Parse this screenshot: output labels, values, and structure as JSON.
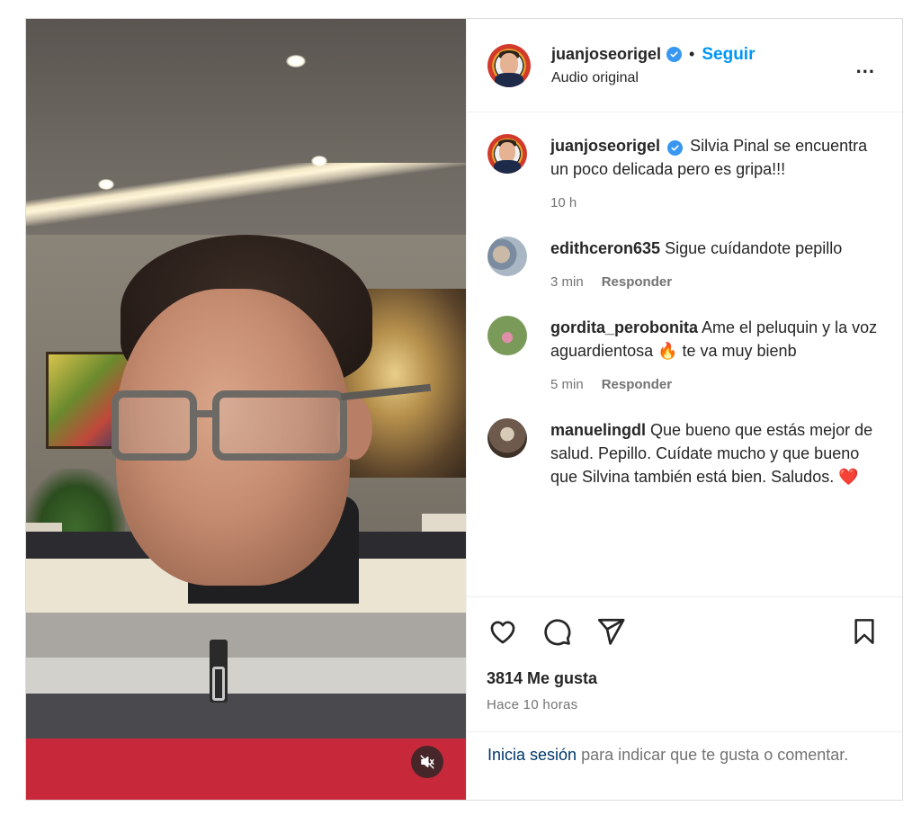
{
  "post": {
    "author": "juanjoseorigel",
    "follow_label": "Seguir",
    "separator": "•",
    "audio": "Audio original",
    "more_label": "..."
  },
  "caption": {
    "user": "juanjoseorigel",
    "text": "Silvia Pinal se encuentra un poco delicada pero es gripa!!!",
    "time": "10 h"
  },
  "comments": [
    {
      "user": "edithceron635",
      "text": "Sigue cuídandote pepillo",
      "time": "3 min",
      "reply": "Responder"
    },
    {
      "user": "gordita_perobonita",
      "text": "Ame el peluquin y la voz aguardientosa 🔥 te va muy bienb",
      "time": "5 min",
      "reply": "Responder"
    },
    {
      "user": "manuelingdl",
      "text": "Que bueno que estás mejor de salud. Pepillo. Cuídate mucho y que bueno que Silvina también está bien. Saludos. ❤️"
    }
  ],
  "stats": {
    "likes": "3814 Me gusta",
    "posted": "Hace 10 horas"
  },
  "login": {
    "link": "Inicia sesión",
    "rest": " para indicar que te gusta o comentar."
  },
  "icons": {
    "like": "heart-icon",
    "comment": "comment-icon",
    "share": "share-icon",
    "save": "bookmark-icon",
    "mute": "muted-speaker-icon",
    "verified": "verified-badge-icon"
  },
  "colors": {
    "accent": "#0095f6",
    "verified": "#3897f0",
    "secondary_text": "#737373",
    "link": "#00376b"
  }
}
